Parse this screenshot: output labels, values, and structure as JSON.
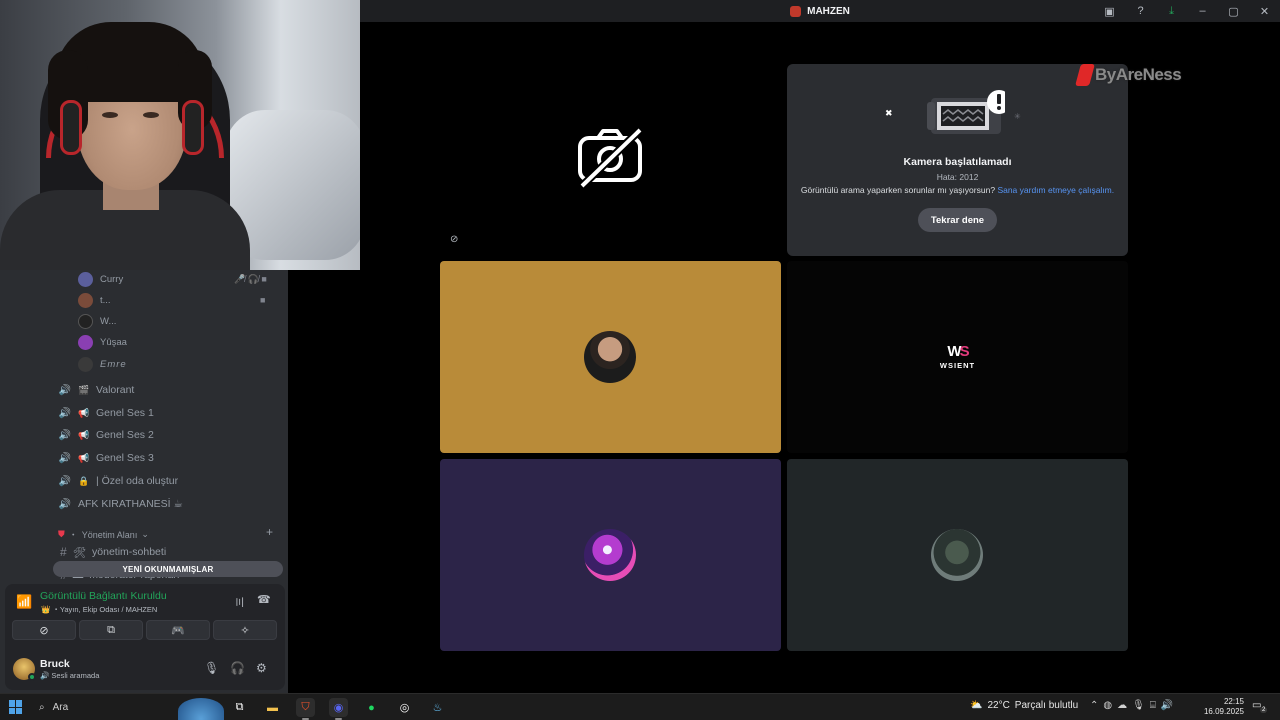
{
  "window": {
    "title": "MAHZEN",
    "controls": [
      "▣",
      "?",
      "⤓",
      "–",
      "▢",
      "✕"
    ]
  },
  "sidebar": {
    "members": [
      {
        "name": "Curry",
        "icons": "🎤̸ 🎧̸ ■",
        "color": "#5b5f9c"
      },
      {
        "name": "t...",
        "icons": "■",
        "color": "#7a4b3a"
      },
      {
        "name": "W...",
        "icons": "",
        "color": "#222"
      },
      {
        "name": "Yûşaa",
        "icons": "",
        "color": "#8a3fb2"
      },
      {
        "name": "Emre",
        "icons": "",
        "color": "#3a3a3a"
      }
    ],
    "channels": [
      {
        "emoji": "🎬",
        "name": "Valorant"
      },
      {
        "emoji": "📢",
        "name": "Genel Ses 1"
      },
      {
        "emoji": "📢",
        "name": "Genel Ses 2"
      },
      {
        "emoji": "📢",
        "name": "Genel Ses 3"
      },
      {
        "emoji": "🔒",
        "name": "| Özel oda oluştur"
      },
      {
        "emoji": "",
        "name": "AFK KIRATHANESİ ☕"
      }
    ],
    "category": {
      "name": "Yönetim Alanı",
      "chevron": "⌄",
      "plus": "+"
    },
    "text_channels": [
      {
        "emoji": "🛠",
        "name": "yönetim-sohbeti"
      },
      {
        "emoji": "▬",
        "name": "moderatör-raporları"
      }
    ],
    "unread_pill": "YENİ OKUNMAMIŞLAR"
  },
  "voice_panel": {
    "title": "Görüntülü Bağlantı Kuruldu",
    "subtitle": "👑 ・Yayın, Ekip Odası / MAHZEN",
    "buttons": [
      "camera-off",
      "screen-share",
      "activity",
      "soundboard"
    ]
  },
  "user_panel": {
    "username": "Bruck",
    "status": "🔊 Sesli aramada"
  },
  "camera_error": {
    "title": "Kamera başlatılamadı",
    "code": "Hata: 2012",
    "help_text": "Görüntülü arama yaparken sorunlar mı yaşıyorsun?",
    "help_link": "Sana yardım etmeye çalışalım.",
    "retry_label": "Tekrar dene"
  },
  "watermark": "ByAreNess",
  "tiles": {
    "ws_logo_text": "WSIENT"
  },
  "taskbar": {
    "search_label": "Ara",
    "weather": {
      "temp": "22°C",
      "desc": "Parçalı bulutlu"
    },
    "time": "22:15",
    "date": "16.09.2025",
    "notifications": "2"
  }
}
